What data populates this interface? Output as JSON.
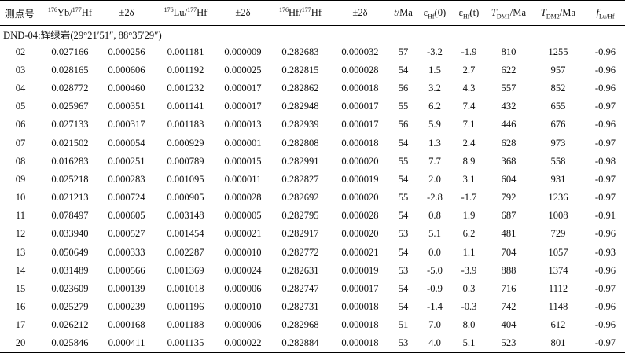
{
  "group_label": "DND-04:辉绿岩(29°21′51″, 88°35′29″)",
  "header": {
    "col0": "测点号",
    "col1": {
      "sup": "176",
      "mid": "Yb/",
      "sup2": "177",
      "tail": "Hf"
    },
    "col2": "±2δ",
    "col3": {
      "sup": "176",
      "mid": "Lu/",
      "sup2": "177",
      "tail": "Hf"
    },
    "col4": "±2δ",
    "col5": {
      "sup": "176",
      "mid": "Hf/",
      "sup2": "177",
      "tail": "Hf"
    },
    "col6": "±2δ",
    "col7": {
      "it": "t",
      "tail": "/Ma"
    },
    "col8": {
      "eps": "ε",
      "sub": "Hf",
      "tail": "(0)"
    },
    "col9": {
      "eps": "ε",
      "sub": "Hf",
      "tail": "(t)"
    },
    "col10": {
      "it": "T",
      "sub": "DM1",
      "tail": "/Ma"
    },
    "col11": {
      "it": "T",
      "sub": "DM2",
      "tail": "/Ma"
    },
    "col12": {
      "it": "f",
      "sub": "Lu/Hf"
    }
  },
  "rows": [
    [
      "02",
      "0.027166",
      "0.000256",
      "0.001181",
      "0.000009",
      "0.282683",
      "0.000032",
      "57",
      "-3.2",
      "-1.9",
      "810",
      "1255",
      "-0.96"
    ],
    [
      "03",
      "0.028165",
      "0.000606",
      "0.001192",
      "0.000025",
      "0.282815",
      "0.000028",
      "54",
      "1.5",
      "2.7",
      "622",
      "957",
      "-0.96"
    ],
    [
      "04",
      "0.028772",
      "0.000460",
      "0.001232",
      "0.000017",
      "0.282862",
      "0.000018",
      "56",
      "3.2",
      "4.3",
      "557",
      "852",
      "-0.96"
    ],
    [
      "05",
      "0.025967",
      "0.000351",
      "0.001141",
      "0.000017",
      "0.282948",
      "0.000017",
      "55",
      "6.2",
      "7.4",
      "432",
      "655",
      "-0.97"
    ],
    [
      "06",
      "0.027133",
      "0.000317",
      "0.001183",
      "0.000013",
      "0.282939",
      "0.000017",
      "56",
      "5.9",
      "7.1",
      "446",
      "676",
      "-0.96"
    ],
    [
      "07",
      "0.021502",
      "0.000054",
      "0.000929",
      "0.000001",
      "0.282808",
      "0.000018",
      "54",
      "1.3",
      "2.4",
      "628",
      "973",
      "-0.97"
    ],
    [
      "08",
      "0.016283",
      "0.000251",
      "0.000789",
      "0.000015",
      "0.282991",
      "0.000020",
      "55",
      "7.7",
      "8.9",
      "368",
      "558",
      "-0.98"
    ],
    [
      "09",
      "0.025218",
      "0.000283",
      "0.001095",
      "0.000011",
      "0.282827",
      "0.000019",
      "54",
      "2.0",
      "3.1",
      "604",
      "931",
      "-0.97"
    ],
    [
      "10",
      "0.021213",
      "0.000724",
      "0.000905",
      "0.000028",
      "0.282692",
      "0.000020",
      "55",
      "-2.8",
      "-1.7",
      "792",
      "1236",
      "-0.97"
    ],
    [
      "11",
      "0.078497",
      "0.000605",
      "0.003148",
      "0.000005",
      "0.282795",
      "0.000028",
      "54",
      "0.8",
      "1.9",
      "687",
      "1008",
      "-0.91"
    ],
    [
      "12",
      "0.033940",
      "0.000527",
      "0.001454",
      "0.000021",
      "0.282917",
      "0.000020",
      "53",
      "5.1",
      "6.2",
      "481",
      "729",
      "-0.96"
    ],
    [
      "13",
      "0.050649",
      "0.000333",
      "0.002287",
      "0.000010",
      "0.282772",
      "0.000021",
      "54",
      "0.0",
      "1.1",
      "704",
      "1057",
      "-0.93"
    ],
    [
      "14",
      "0.031489",
      "0.000566",
      "0.001369",
      "0.000024",
      "0.282631",
      "0.000019",
      "53",
      "-5.0",
      "-3.9",
      "888",
      "1374",
      "-0.96"
    ],
    [
      "15",
      "0.023609",
      "0.000139",
      "0.001018",
      "0.000006",
      "0.282747",
      "0.000017",
      "54",
      "-0.9",
      "0.3",
      "716",
      "1112",
      "-0.97"
    ],
    [
      "16",
      "0.025279",
      "0.000239",
      "0.001196",
      "0.000010",
      "0.282731",
      "0.000018",
      "54",
      "-1.4",
      "-0.3",
      "742",
      "1148",
      "-0.96"
    ],
    [
      "17",
      "0.026212",
      "0.000168",
      "0.001188",
      "0.000006",
      "0.282968",
      "0.000018",
      "51",
      "7.0",
      "8.0",
      "404",
      "612",
      "-0.96"
    ],
    [
      "20",
      "0.025846",
      "0.000411",
      "0.001135",
      "0.000022",
      "0.282884",
      "0.000018",
      "53",
      "4.0",
      "5.1",
      "523",
      "801",
      "-0.97"
    ]
  ]
}
